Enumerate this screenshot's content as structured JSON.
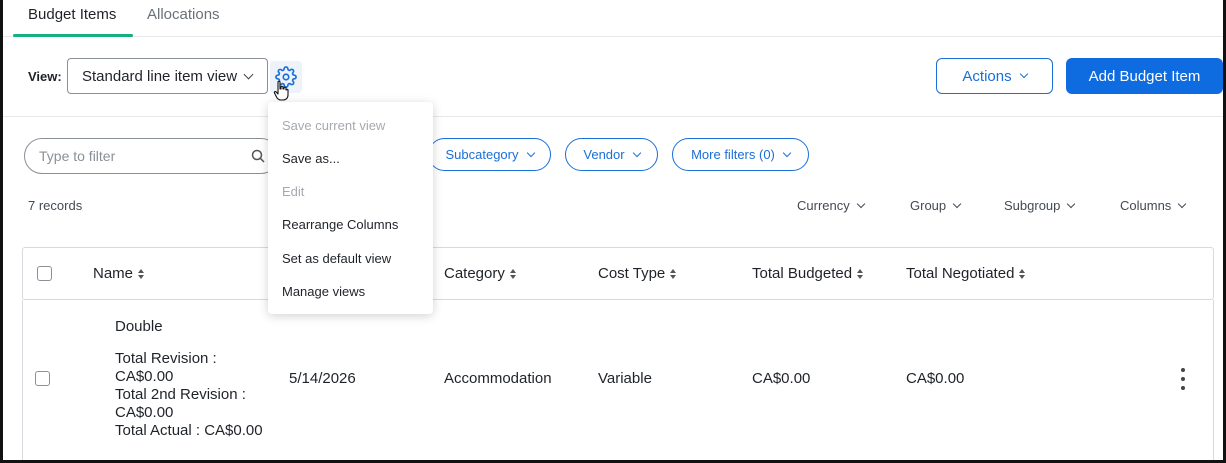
{
  "tabs": [
    {
      "label": "Budget Items",
      "active": true
    },
    {
      "label": "Allocations",
      "active": false
    }
  ],
  "view": {
    "label": "View:",
    "selected": "Standard line item view"
  },
  "header_buttons": {
    "actions_label": "Actions",
    "add_label": "Add Budget Item"
  },
  "filters": {
    "search_placeholder": "Type to filter",
    "pills": [
      "Subcategory",
      "Vendor",
      "More filters (0)"
    ]
  },
  "records_count": "7 records",
  "group_controls": [
    "Currency",
    "Group",
    "Subgroup",
    "Columns"
  ],
  "table": {
    "columns": [
      "Name",
      "Category",
      "Cost Type",
      "Total Budgeted",
      "Total Negotiated"
    ],
    "rows": [
      {
        "name": "Double",
        "details": [
          "Total Revision :",
          "CA$0.00",
          "Total 2nd Revision :",
          "CA$0.00",
          "Total Actual : CA$0.00"
        ],
        "date": "5/14/2026",
        "category": "Accommodation",
        "cost_type": "Variable",
        "total_budgeted": "CA$0.00",
        "total_negotiated": "CA$0.00"
      }
    ]
  },
  "view_menu": {
    "items": [
      {
        "label": "Save current view",
        "disabled": true
      },
      {
        "label": "Save as...",
        "disabled": false
      },
      {
        "label": "Edit",
        "disabled": true
      },
      {
        "label": "Rearrange Columns",
        "disabled": false
      },
      {
        "label": "Set as default view",
        "disabled": false
      },
      {
        "label": "Manage views",
        "disabled": false
      }
    ]
  },
  "colors": {
    "accent_blue": "#0f6be0",
    "tab_underline_green": "#14b07f",
    "disabled_text": "#a5aab0"
  },
  "icons": [
    "gear-icon",
    "chevron-down-icon",
    "search-icon",
    "sort-icon",
    "kebab-menu-icon",
    "hand-cursor-icon"
  ]
}
